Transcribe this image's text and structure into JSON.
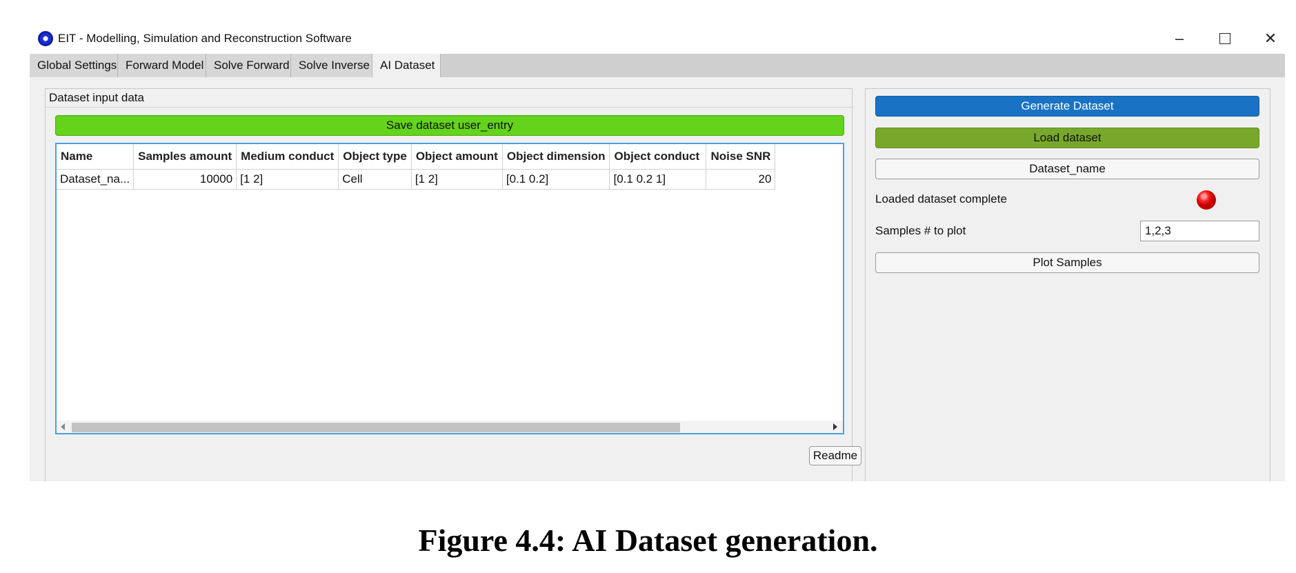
{
  "window": {
    "title": "EIT - Modelling, Simulation and Reconstruction Software",
    "controls": {
      "minimize": "–",
      "close": "✕"
    }
  },
  "tabs": [
    {
      "label": "Global Settings",
      "active": false
    },
    {
      "label": "Forward Model",
      "active": false
    },
    {
      "label": "Solve Forward",
      "active": false
    },
    {
      "label": "Solve Inverse",
      "active": false
    },
    {
      "label": "AI Dataset",
      "active": true
    }
  ],
  "left_panel": {
    "title": "Dataset input data",
    "save_button": "Save dataset user_entry",
    "table": {
      "columns": [
        "Name",
        "Samples amount",
        "Medium conduct",
        "Object type",
        "Object amount",
        "Object dimension",
        "Object conduct",
        "Noise SNR"
      ],
      "rows": [
        [
          "Dataset_na...",
          "10000",
          "[1 2]",
          "Cell",
          "[1 2]",
          "[0.1 0.2]",
          "[0.1 0.2 1]",
          "20"
        ]
      ]
    },
    "readme_button": "Readme"
  },
  "right_panel": {
    "generate_button": "Generate Dataset",
    "load_button": "Load dataset",
    "dataset_name_button": "Dataset_name",
    "loaded_label": "Loaded dataset complete",
    "loaded_status_color": "#ff2020",
    "samples_label": "Samples # to plot",
    "samples_value": "1,2,3",
    "plot_button": "Plot Samples"
  },
  "caption": "Figure 4.4: AI Dataset generation.",
  "colors": {
    "save_green": "#63d31b",
    "generate_blue": "#1a72c4",
    "load_green": "#77a82c",
    "table_border": "#4aa0e0"
  }
}
